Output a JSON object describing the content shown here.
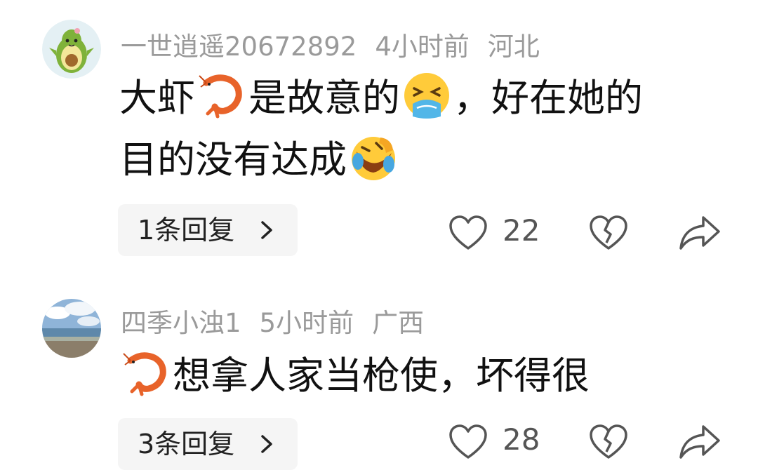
{
  "comments": [
    {
      "username": "一世逍遥20672892",
      "time": "4小时前",
      "location": "河北",
      "avatar_icon": "avocado-avatar-icon",
      "body_line1": [
        "大虾",
        "是故意的",
        "，好在她的"
      ],
      "body_line2": [
        "目的没有达成"
      ],
      "emojis": [
        "shrimp-emoji",
        "nauseated-emoji",
        "rolling-laughing-emoji"
      ],
      "reply_label": "1条回复",
      "like_count": "22"
    },
    {
      "username": "四季小浊1",
      "time": "5小时前",
      "location": "广西",
      "avatar_icon": "beach-photo-avatar",
      "body_line1": [
        "想拿人家当枪使，坏得很"
      ],
      "emojis": [
        "shrimp-emoji"
      ],
      "reply_label": "3条回复",
      "like_count": "28"
    }
  ],
  "colors": {
    "meta_text": "#9a9a9a",
    "body_text": "#111111",
    "reply_bg": "#f5f5f5",
    "icon_stroke": "#555555"
  }
}
